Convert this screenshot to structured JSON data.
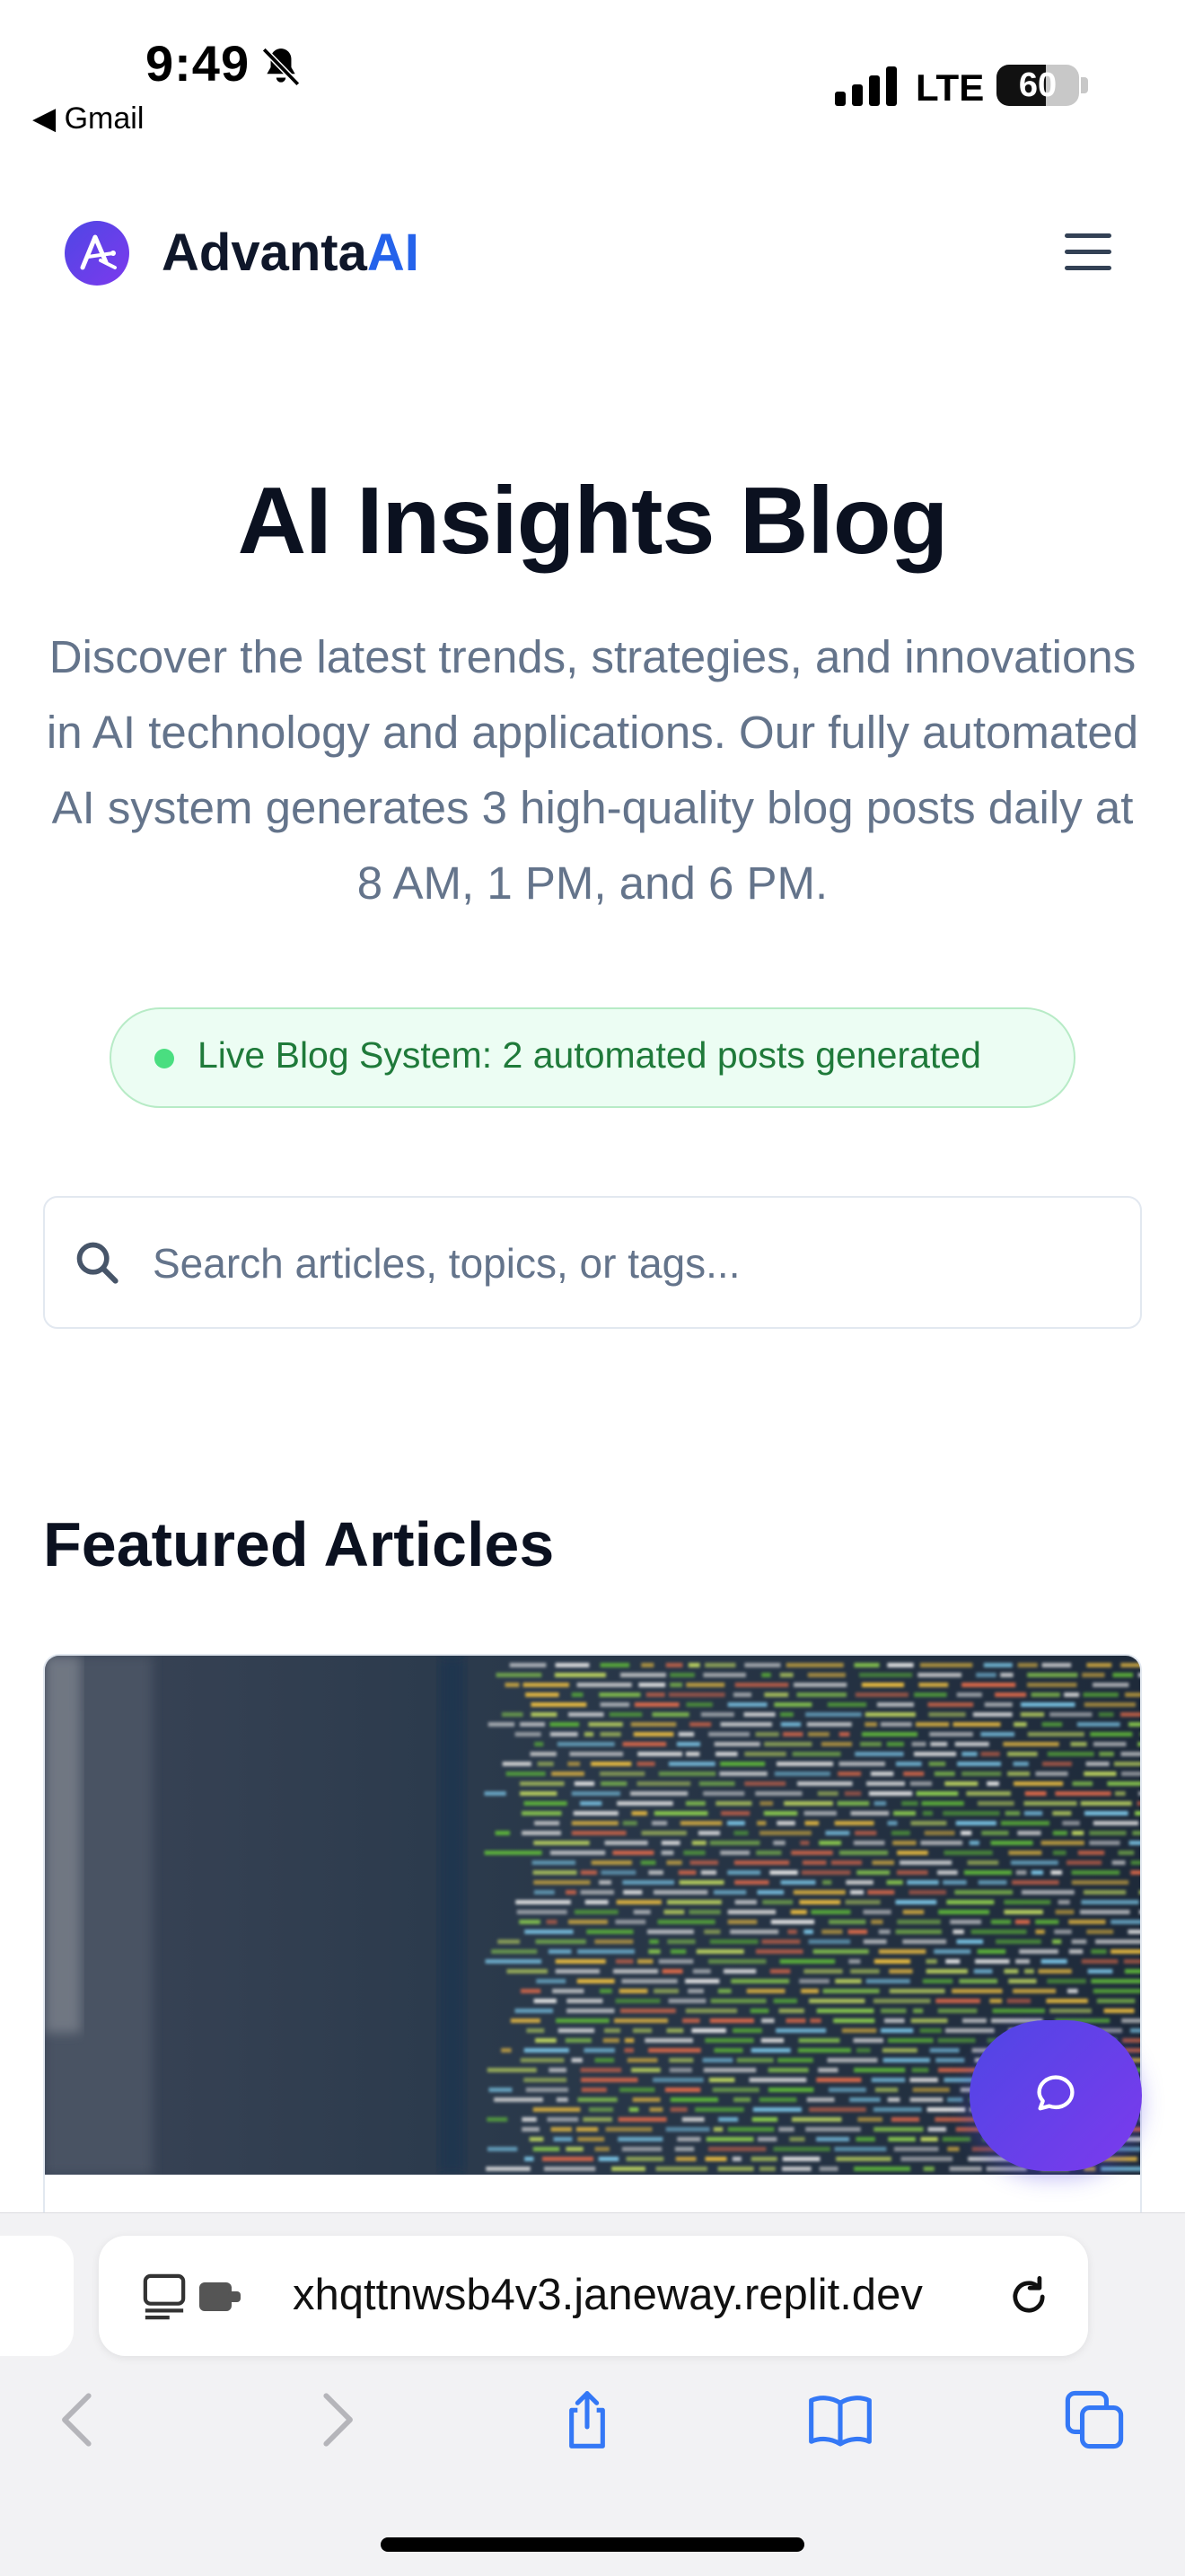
{
  "status_bar": {
    "time": "9:49",
    "back_app": "◀ Gmail",
    "network": "LTE",
    "battery": "60",
    "battery_level": 0.6
  },
  "header": {
    "brand_prefix": "Advanta",
    "brand_suffix": "AI",
    "menu_icon": "hamburger-menu-icon"
  },
  "hero": {
    "title": "AI Insights Blog",
    "description": "Discover the latest trends, strategies, and innovations in AI technology and applications. Our fully automated AI system generates 3 high-quality blog posts daily at 8 AM, 1 PM, and 6 PM."
  },
  "status_pill": {
    "text": "Live Blog System: 2 automated posts generated"
  },
  "search": {
    "placeholder": "Search articles, topics, or tags...",
    "value": ""
  },
  "featured": {
    "heading": "Featured Articles"
  },
  "browser": {
    "url": "xhqttnwsb4v3.janeway.replit.dev",
    "icons": [
      "back-icon",
      "forward-icon",
      "share-icon",
      "bookmarks-icon",
      "tabs-icon"
    ]
  },
  "colors": {
    "brand_accent": "#2563eb",
    "brand_gradient_start": "#4f46e5",
    "brand_gradient_end": "#7c3aed",
    "status_green": "#1f7a3a",
    "ios_blue": "#3478f6"
  }
}
